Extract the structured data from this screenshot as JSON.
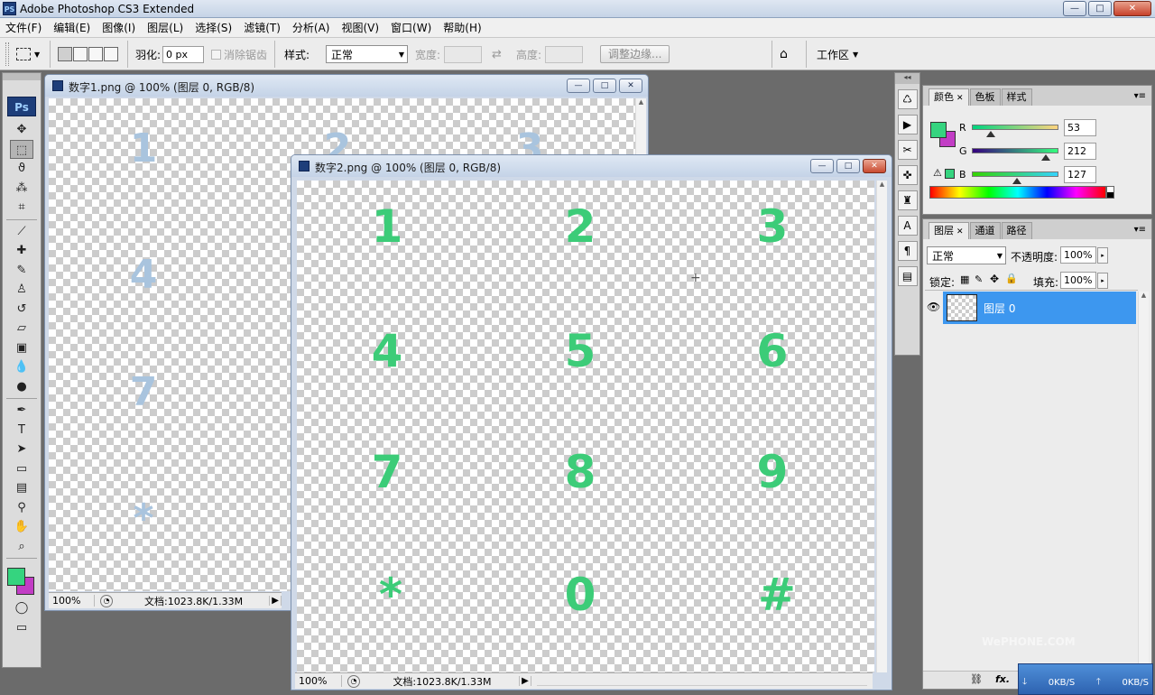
{
  "app": {
    "title": "Adobe Photoshop CS3 Extended",
    "icon": "PS"
  },
  "window_controls": {
    "minimize": "—",
    "maximize": "□",
    "close": "✕"
  },
  "menu": [
    "文件(F)",
    "编辑(E)",
    "图像(I)",
    "图层(L)",
    "选择(S)",
    "滤镜(T)",
    "分析(A)",
    "视图(V)",
    "窗口(W)",
    "帮助(H)"
  ],
  "options": {
    "feather_label": "羽化:",
    "feather_value": "0 px",
    "antialias_label": "消除锯齿",
    "style_label": "样式:",
    "style_value": "正常",
    "width_label": "宽度:",
    "height_label": "高度:",
    "refine_button": "调整边缘...",
    "workspace_label": "工作区"
  },
  "toolbox": {
    "logo": "Ps",
    "tools": [
      {
        "name": "move-tool",
        "icon": "✥"
      },
      {
        "name": "marquee-tool",
        "icon": "⬚"
      },
      {
        "name": "lasso-tool",
        "icon": "ϑ"
      },
      {
        "name": "magic-wand-tool",
        "icon": "⁂"
      },
      {
        "name": "crop-tool",
        "icon": "⌗"
      },
      {
        "name": "slice-tool",
        "icon": "⟋"
      },
      {
        "name": "healing-brush-tool",
        "icon": "✚"
      },
      {
        "name": "brush-tool",
        "icon": "✎"
      },
      {
        "name": "clone-stamp-tool",
        "icon": "♙"
      },
      {
        "name": "history-brush-tool",
        "icon": "↺"
      },
      {
        "name": "eraser-tool",
        "icon": "▱"
      },
      {
        "name": "gradient-tool",
        "icon": "▣"
      },
      {
        "name": "blur-tool",
        "icon": "💧"
      },
      {
        "name": "dodge-tool",
        "icon": "●"
      },
      {
        "name": "pen-tool",
        "icon": "✒"
      },
      {
        "name": "type-tool",
        "icon": "T"
      },
      {
        "name": "path-selection-tool",
        "icon": "➤"
      },
      {
        "name": "rectangle-tool",
        "icon": "▭"
      },
      {
        "name": "notes-tool",
        "icon": "▤"
      },
      {
        "name": "eyedropper-tool",
        "icon": "⚲"
      },
      {
        "name": "hand-tool",
        "icon": "✋"
      },
      {
        "name": "zoom-tool",
        "icon": "⌕"
      }
    ],
    "foreground_color": "#35d47f",
    "background_color": "#c23dc5"
  },
  "doc1": {
    "title": "数字1.png @ 100% (图层 0, RGB/8)",
    "zoom": "100%",
    "doc_info": "文档:1023.8K/1.33M",
    "digits": [
      "1",
      "2",
      "3",
      "4",
      "7",
      "*"
    ],
    "digit_color": "#a9c4de"
  },
  "doc2": {
    "title": "数字2.png @ 100% (图层 0, RGB/8)",
    "zoom": "100%",
    "doc_info": "文档:1023.8K/1.33M",
    "digits": [
      "1",
      "2",
      "3",
      "4",
      "5",
      "6",
      "7",
      "8",
      "9",
      "*",
      "0",
      "#"
    ],
    "digit_color": "#3ccc78"
  },
  "color_panel": {
    "tabs": [
      "颜色",
      "色板",
      "样式"
    ],
    "r_label": "R",
    "r_value": "53",
    "g_label": "G",
    "g_value": "212",
    "b_label": "B",
    "b_value": "127",
    "warning_icon": "⚠",
    "fg": "#35d47f",
    "bg": "#c23dc5"
  },
  "layers_panel": {
    "tabs": [
      "图层",
      "通道",
      "路径"
    ],
    "blend_mode": "正常",
    "opacity_label": "不透明度:",
    "opacity_value": "100%",
    "lock_label": "锁定:",
    "fill_label": "填充:",
    "fill_value": "100%",
    "layer_name": "图层 0",
    "footer_fx": "fx."
  },
  "tray": {
    "down_speed": "0KB/S",
    "up_speed": "0KB/S"
  },
  "watermark": "WePHONE.COM"
}
